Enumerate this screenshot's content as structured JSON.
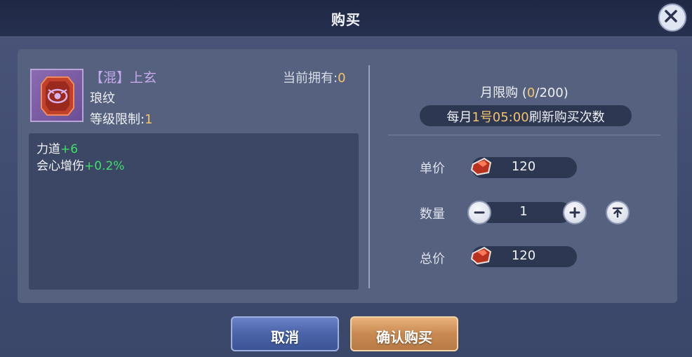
{
  "dialog": {
    "title": "购买"
  },
  "item": {
    "name": "【混】上玄",
    "subtitle": "琅纹",
    "level_label": "等级限制:",
    "level_value": "1",
    "owned_label": "当前拥有:",
    "owned_value": "0"
  },
  "attributes": [
    {
      "label": "力道",
      "value": "+6"
    },
    {
      "label": "会心增伤",
      "value": "+0.2%"
    }
  ],
  "limit": {
    "label": "月限购 (",
    "used": "0",
    "total_text": "/200)",
    "refresh_prefix": "每月",
    "refresh_day": "1号05:00",
    "refresh_suffix": "刷新购买次数"
  },
  "purchase": {
    "unit_price_label": "单价",
    "unit_price": "120",
    "quantity_label": "数量",
    "quantity": "1",
    "total_label": "总价",
    "total": "120"
  },
  "buttons": {
    "cancel": "取消",
    "confirm": "确认购买"
  },
  "colors": {
    "gold": "#f2c36b",
    "bonus_green": "#3fe06a",
    "item_purple": "#c6a8ec"
  },
  "icons": {
    "close": "close-icon",
    "item": "talisman-item-icon",
    "currency": "red-gem-currency-icon",
    "minus": "minus-icon",
    "plus": "plus-icon",
    "max": "max-arrow-icon"
  }
}
